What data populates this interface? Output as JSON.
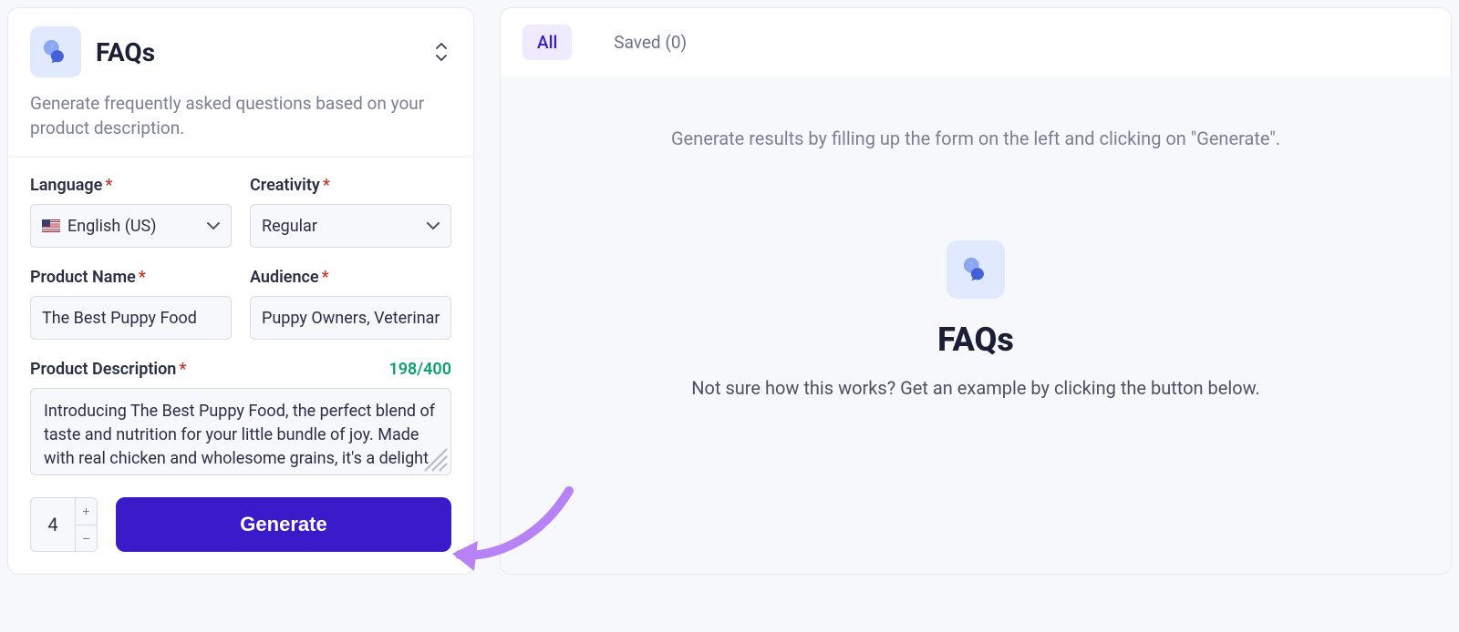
{
  "left": {
    "title": "FAQs",
    "subtitle": "Generate frequently asked questions based on your product description.",
    "fields": {
      "language": {
        "label": "Language",
        "value": "English (US)"
      },
      "creativity": {
        "label": "Creativity",
        "value": "Regular"
      },
      "productName": {
        "label": "Product Name",
        "value": "The Best Puppy Food"
      },
      "audience": {
        "label": "Audience",
        "value": "Puppy Owners, Veterinarians"
      },
      "description": {
        "label": "Product Description",
        "counter": "198/400",
        "value": "Introducing The Best Puppy Food, the perfect blend of taste and nutrition for your little bundle of joy. Made with real chicken and wholesome grains, it's a delight your puppy will wag its tail for."
      }
    },
    "stepperValue": "4",
    "generateLabel": "Generate"
  },
  "right": {
    "tabs": {
      "all": "All",
      "saved": "Saved (0)"
    },
    "hint": "Generate results by filling up the form on the left and clicking on \"Generate\".",
    "empty": {
      "title": "FAQs",
      "sub": "Not sure how this works? Get an example by clicking the button below."
    }
  }
}
